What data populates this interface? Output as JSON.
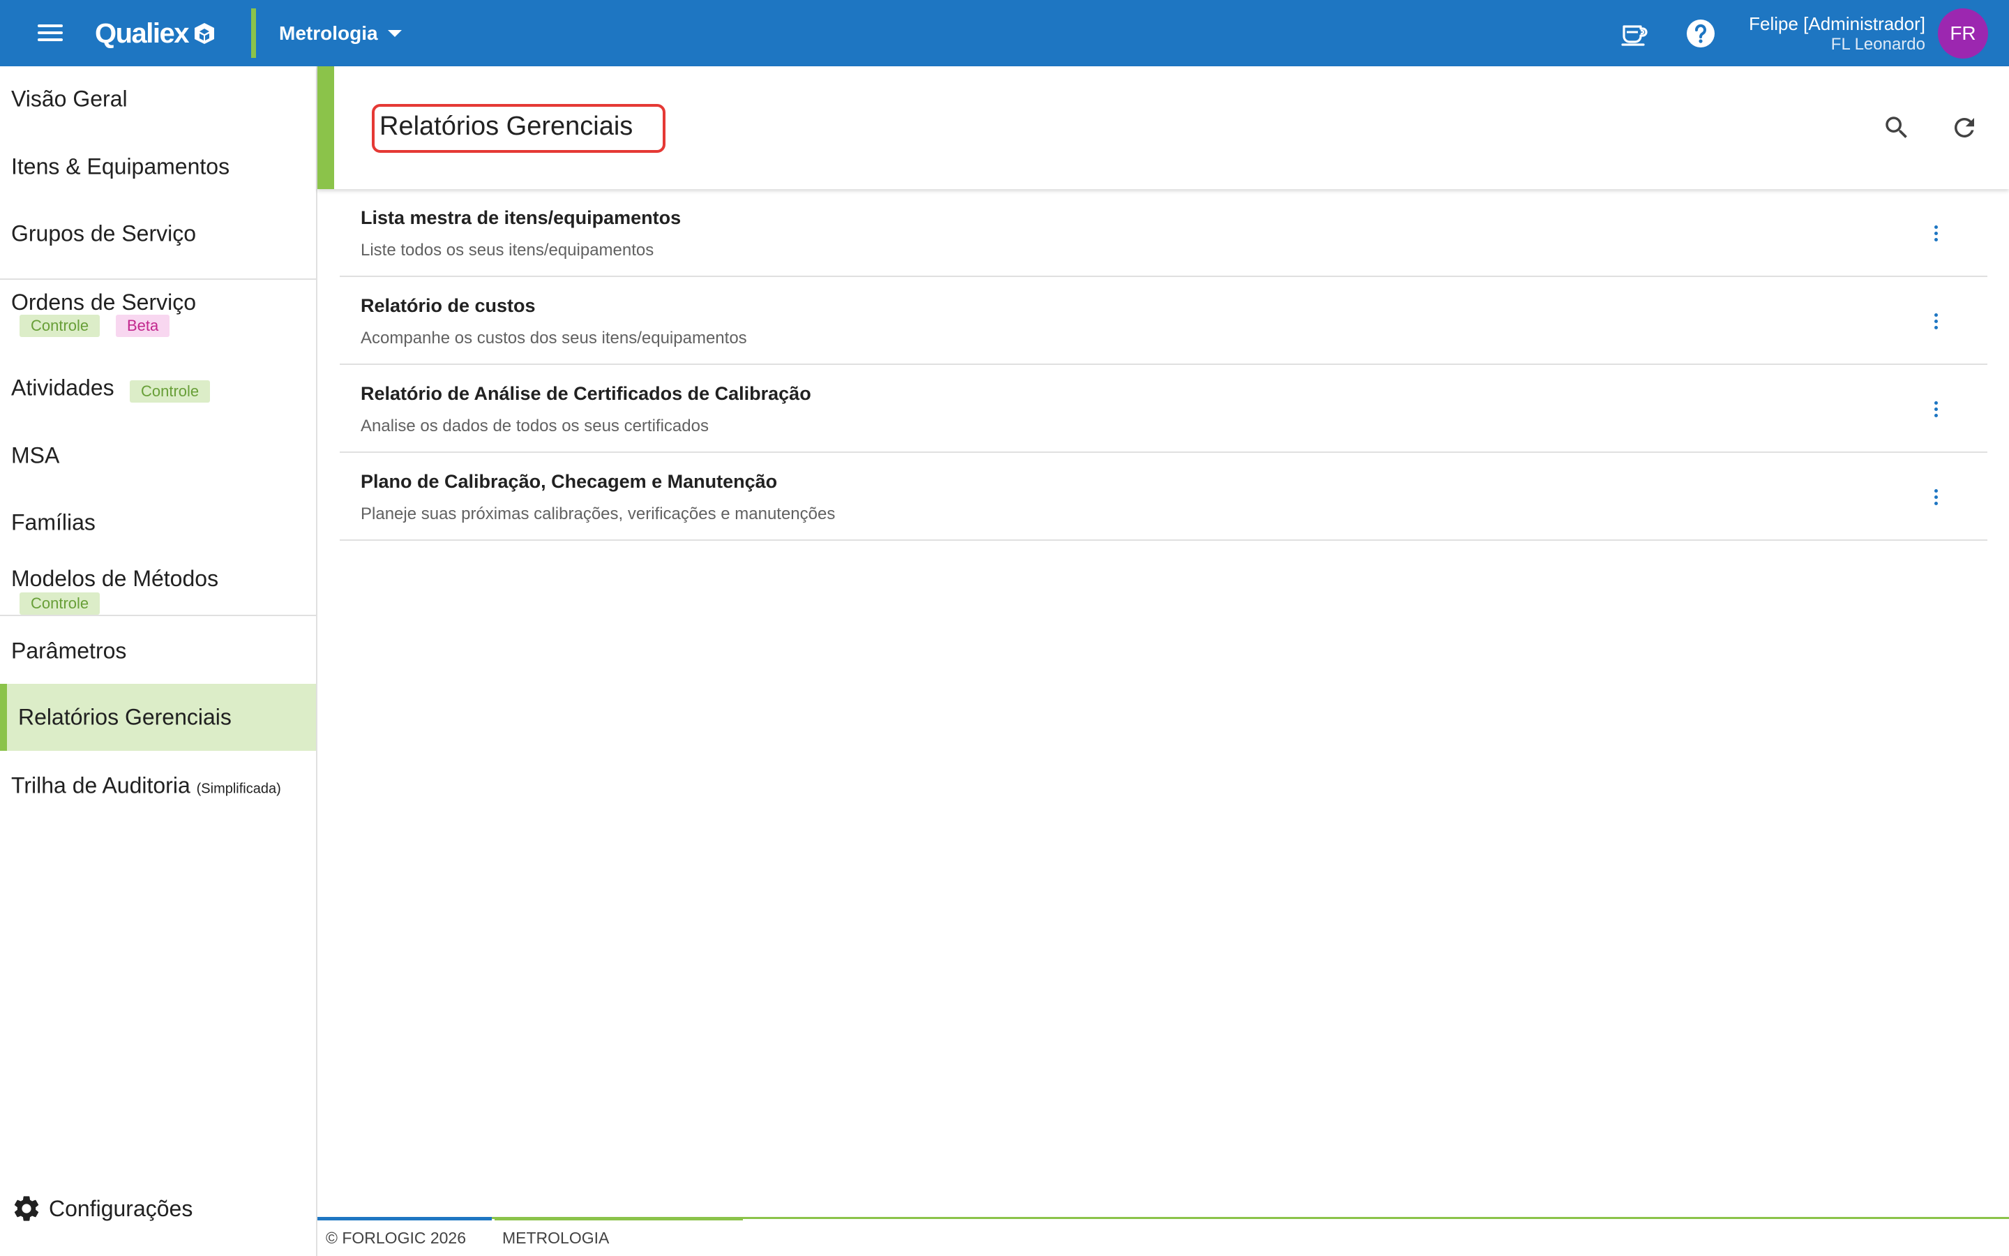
{
  "header": {
    "logo_text": "Qualiex",
    "module": "Metrologia",
    "user_name": "Felipe [Administrador]",
    "user_org": "FL Leonardo",
    "avatar_initials": "FR",
    "bar_color": "#1e76c2",
    "avatar_color": "#9c27b0"
  },
  "sidebar": {
    "items": [
      {
        "label": "Visão Geral"
      },
      {
        "label": "Itens & Equipamentos"
      },
      {
        "label": "Grupos de Serviço"
      },
      {
        "label": "Ordens de Serviço",
        "tags": [
          "Controle",
          "Beta"
        ]
      },
      {
        "label": "Atividades",
        "tags": [
          "Controle"
        ]
      },
      {
        "label": "MSA"
      },
      {
        "label": "Famílias"
      },
      {
        "label": "Modelos de Métodos",
        "tags": [
          "Controle"
        ]
      },
      {
        "label": "Parâmetros"
      },
      {
        "label": "Relatórios Gerenciais",
        "active": true
      },
      {
        "label": "Trilha de Auditoria",
        "note": "(Simplificada)"
      }
    ],
    "settings_label": "Configurações",
    "accent_color": "#8bc34a"
  },
  "main": {
    "title": "Relatórios Gerenciais",
    "reports": [
      {
        "title": "Lista mestra de itens/equipamentos",
        "description": "Liste todos os seus itens/equipamentos"
      },
      {
        "title": "Relatório de custos",
        "description": "Acompanhe os custos dos seus itens/equipamentos"
      },
      {
        "title": "Relatório de Análise de Certificados de Calibração",
        "description": "Analise os dados de todos os seus certificados"
      },
      {
        "title": "Plano de Calibração, Checagem e Manutenção",
        "description": "Planeje suas próximas calibrações, verificações e manutenções"
      }
    ]
  },
  "footer": {
    "copyright": "© FORLOGIC 2026",
    "module": "METROLOGIA"
  }
}
